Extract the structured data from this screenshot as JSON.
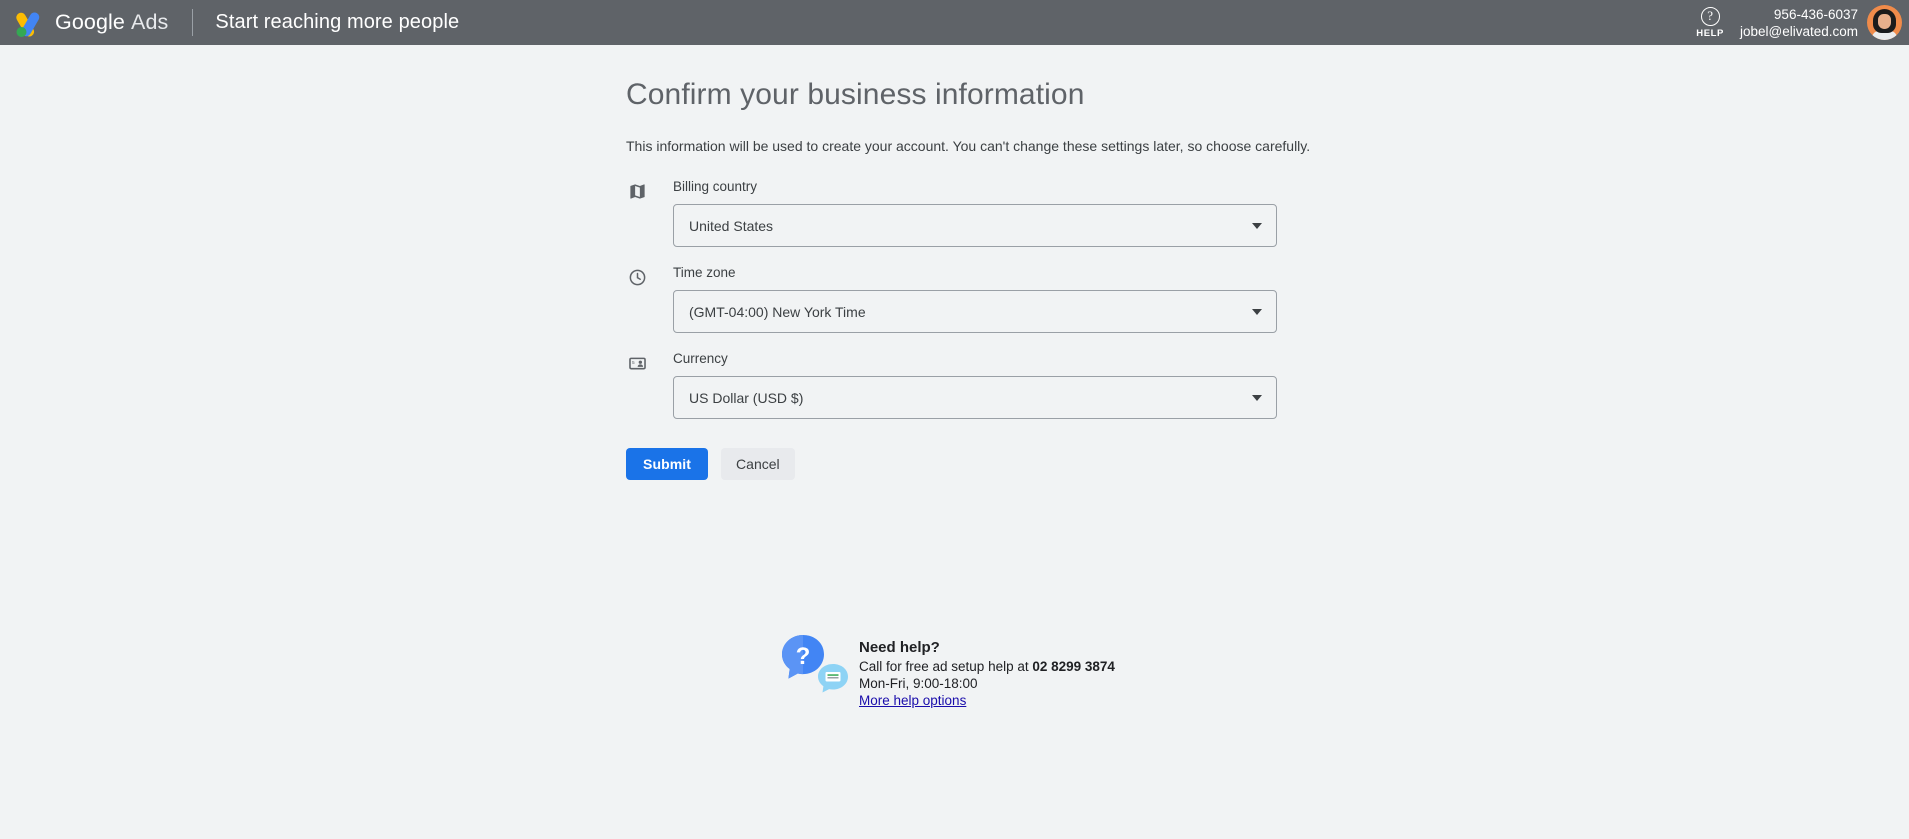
{
  "header": {
    "brand_google": "Google",
    "brand_ads": "Ads",
    "tagline": "Start reaching more people",
    "help_label": "HELP",
    "help_glyph": "?",
    "account_phone": "956-436-6037",
    "account_email": "jobel@elivated.com",
    "icons": {
      "logo": "google-ads-logo-icon",
      "help": "help-circle-icon",
      "avatar": "user-avatar-icon"
    }
  },
  "main": {
    "title": "Confirm your business information",
    "subtitle": "This information will be used to create your account. You can't change these settings later, so choose carefully.",
    "fields": [
      {
        "label": "Billing country",
        "value": "United States",
        "icon": "map-icon"
      },
      {
        "label": "Time zone",
        "value": "(GMT-04:00) New York Time",
        "icon": "clock-icon"
      },
      {
        "label": "Currency",
        "value": "US Dollar (USD $)",
        "icon": "payment-card-icon"
      }
    ],
    "submit_label": "Submit",
    "cancel_label": "Cancel"
  },
  "help_footer": {
    "title": "Need help?",
    "call_prefix": "Call for free ad setup help at ",
    "phone": "02 8299 3874",
    "hours": "Mon-Fri, 9:00-18:00",
    "more_options": "More help options",
    "icon": "help-chat-bubble-icon"
  },
  "colors": {
    "topbar_bg": "#5f6368",
    "page_bg": "#f1f3f4",
    "accent_blue": "#1a73e8",
    "link_blue": "#1a0dab",
    "text_primary": "#3c4043",
    "title_gray": "#5f6368"
  }
}
